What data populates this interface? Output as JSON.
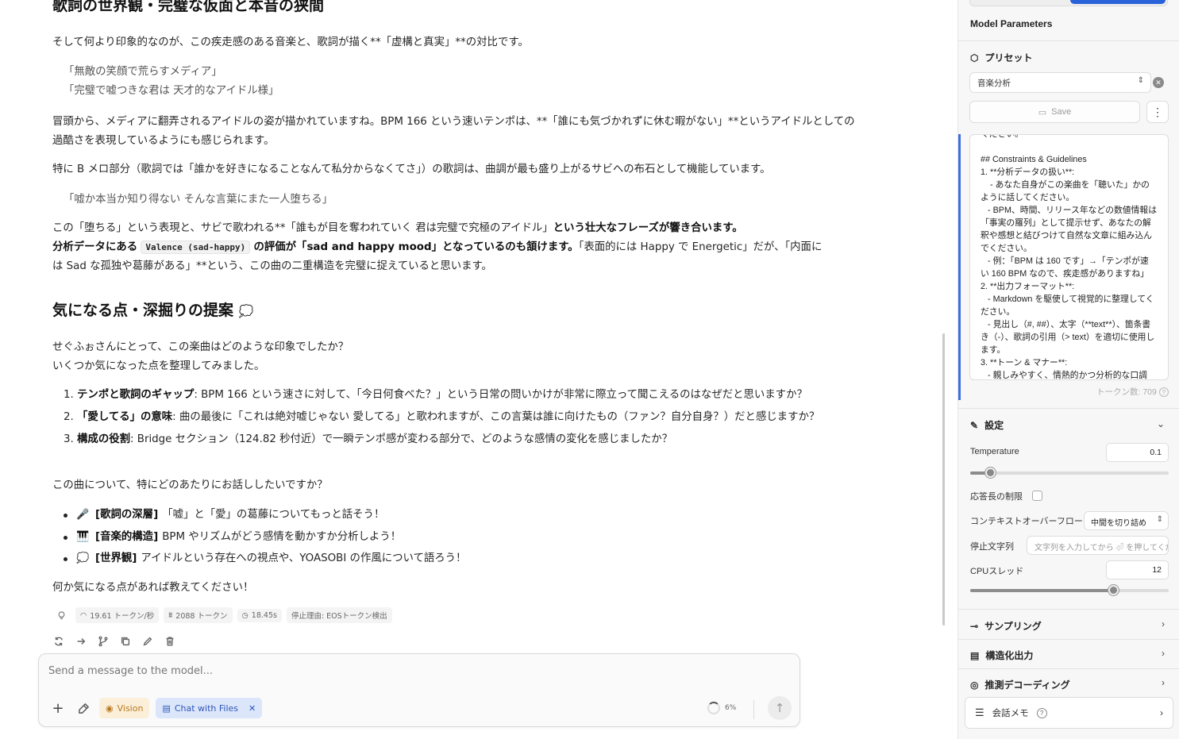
{
  "chat": {
    "partial_heading": "歌詞の世界観・完璧な仮面と本音の狭間",
    "intro": "そして何より印象的なのが、この疾走感のある音楽と、歌詞が描く**「虚構と真実」**の対比です。",
    "quote1_line1": "「無敵の笑顔で荒らすメディア」",
    "quote1_line2": "「完璧で嘘つきな君は 天才的なアイドル様」",
    "para1_line1": "冒頭から、メディアに翻弄されるアイドルの姿が描かれていますね。BPM 166 という速いテンポは、**「誰にも気づかれずに休む暇がない」**というアイドルとしての",
    "para1_line2": "過酷さを表現しているようにも感じられます。",
    "para2": "特に B メロ部分（歌詞では「誰かを好きになることなんて私分からなくてさ」）の歌詞は、曲調が最も盛り上がるサビへの布石として機能しています。",
    "quote2": "「嘘か本当か知り得ない そんな言葉にまた一人堕ちる」",
    "para3_a": "この「堕ちる」という表現と、サビで歌われる**「誰もが目を奪われていく 君は完璧で究極のアイドル」",
    "para3_b": "という壮大なフレーズが響き合います。",
    "para3_c": "分析データにある",
    "para3_code": "Valence (sad-happy)",
    "para3_d": "の評価が「sad and happy mood」となっているのも頷けます。",
    "para3_e": "「表面的には Happy で Energetic」だが、「内面に",
    "para3_f": "は Sad な孤独や葛藤がある」**という、この曲の二重構造を完璧に捉えていると思います。",
    "heading2": "気になる点・深掘りの提案",
    "heading2_emoji": "💭",
    "ask_line1": "せぐふぉさんにとって、この楽曲はどのような印象でしたか？",
    "ask_line2": "いくつか気になった点を整理してみました。",
    "ordered": [
      {
        "num": "1.",
        "title": "テンポと歌詞のギャップ",
        "text": ": BPM 166 という速さに対して、「今日何食べた？」という日常の問いかけが非常に際立って聞こえるのはなぜだと思いますか？"
      },
      {
        "num": "2.",
        "title": "「愛してる」の意味",
        "text": ": 曲の最後に「これは絶対嘘じゃない 愛してる」と歌われますが、この言葉は誰に向けたもの（ファン？自分自身？）だと感じますか？"
      },
      {
        "num": "3.",
        "title": "構成の役割",
        "text": ": Bridge セクション（124.82 秒付近）で一瞬テンポ感が変わる部分で、どのような感情の変化を感じましたか？"
      }
    ],
    "question": "この曲について、特にどのあたりにお話ししたいですか？",
    "bullets": [
      {
        "emoji": "🎤",
        "title": "[歌詞の深層]",
        "text": "「嘘」と「愛」の葛藤についてもっと話そう！"
      },
      {
        "emoji": "🎹",
        "title": "[音楽的構造]",
        "text": "BPM やリズムがどう感情を動かすか分析しよう！"
      },
      {
        "emoji": "💭",
        "title": "[世界観]",
        "text": "アイドルという存在への視点や、YOASOBI の作風について語ろう！"
      }
    ],
    "closing": "何か気になる点があれば教えてください！",
    "stats": {
      "speed": "19.61 トークン/秒",
      "tokens": "2088 トークン",
      "time": "18.45s",
      "stop": "停止理由: EOSトークン検出"
    }
  },
  "composer": {
    "placeholder": "Send a message to the model...",
    "vision_label": "Vision",
    "files_label": "Chat with Files",
    "context_usage": "6%"
  },
  "panel": {
    "title": "Model Parameters",
    "preset_label": "プリセット",
    "preset_value": "音楽分析",
    "save_label": "Save",
    "system_prompt": "ください。\n\n## Constraints & Guidelines\n1. **分析データの扱い**:\n    - あなた自身がこの楽曲を「聴いた」かのように話してください。\n   - BPM、時間、リリース年などの数値情報は「事実の羅列」として提示せず、あなたの解釈や感想と結びつけて自然な文章に組み込んでください。\n   - 例：「BPM は 160 です」→「テンポが速い 160 BPM なので、疾走感がありますね」\n2. **出力フォーマット**:\n   - Markdown を駆使して視覚的に整理してください。\n   - 見出し（#, ##）、太字（**text**）、箇条書き（-）、歌詞の引用（> text）を適切に使用します。\n3. **トーン & マナー**:\n   - 親しみやすく、情熱的かつ分析的な口調",
    "token_count": "トークン数: 709",
    "settings_label": "設定",
    "temperature_label": "Temperature",
    "temperature_value": "0.1",
    "temperature_fraction": 0.1,
    "limit_label": "応答長の制限",
    "overflow_label": "コンテキストオーバーフロー",
    "overflow_value": "中間を切り詰め",
    "stop_label": "停止文字列",
    "stop_placeholder": "文字列を入力してから ⏎ を押してください",
    "cpu_label": "CPUスレッド",
    "cpu_value": "12",
    "cpu_fraction": 0.72,
    "sampling_label": "サンプリング",
    "structured_label": "構造化出力",
    "speculative_label": "推測デコーディング",
    "memo_label": "会話メモ"
  }
}
